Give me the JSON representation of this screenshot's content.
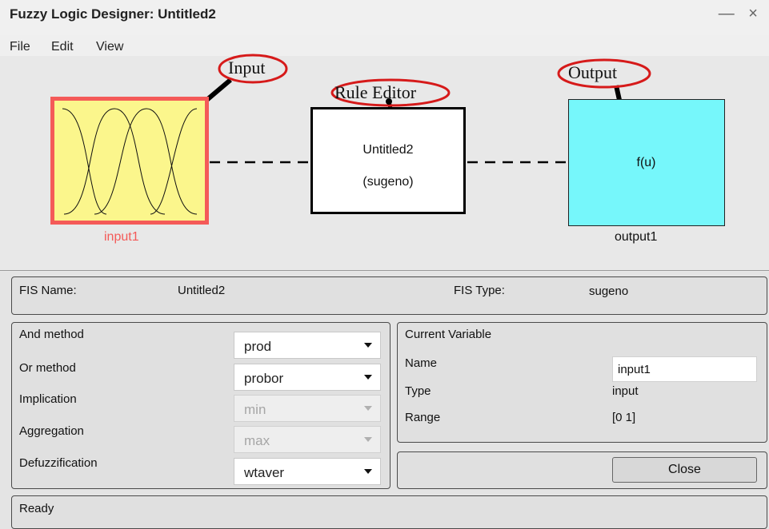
{
  "window": {
    "title": "Fuzzy Logic Designer: Untitled2",
    "controls": "— ×"
  },
  "menu": [
    "File",
    "Edit",
    "View"
  ],
  "diagram": {
    "annotations": {
      "input": "Input",
      "rule_editor": "Rule Editor",
      "output": "Output"
    },
    "input_block": {
      "label": "input1"
    },
    "rule_block": {
      "name": "Untitled2",
      "type": "(sugeno)"
    },
    "output_block": {
      "text": "f(u)",
      "label": "output1"
    },
    "colors": {
      "input_fill": "#fbf68c",
      "input_border": "#f45a58",
      "output_fill": "#76f7fb",
      "annotation_red": "#d61a1a"
    }
  },
  "fis_info": {
    "name_label": "FIS Name:",
    "name_value": "Untitled2",
    "type_label": "FIS Type:",
    "type_value": "sugeno"
  },
  "methods": [
    {
      "label": "And method",
      "value": "prod",
      "enabled": true
    },
    {
      "label": "Or method",
      "value": "probor",
      "enabled": true
    },
    {
      "label": "Implication",
      "value": "min",
      "enabled": false
    },
    {
      "label": "Aggregation",
      "value": "max",
      "enabled": false
    },
    {
      "label": "Defuzzification",
      "value": "wtaver",
      "enabled": true
    }
  ],
  "current_variable": {
    "title": "Current Variable",
    "name_label": "Name",
    "name_value": "input1",
    "type_label": "Type",
    "type_value": "input",
    "range_label": "Range",
    "range_value": "[0 1]"
  },
  "close_label": "Close",
  "status": "Ready"
}
